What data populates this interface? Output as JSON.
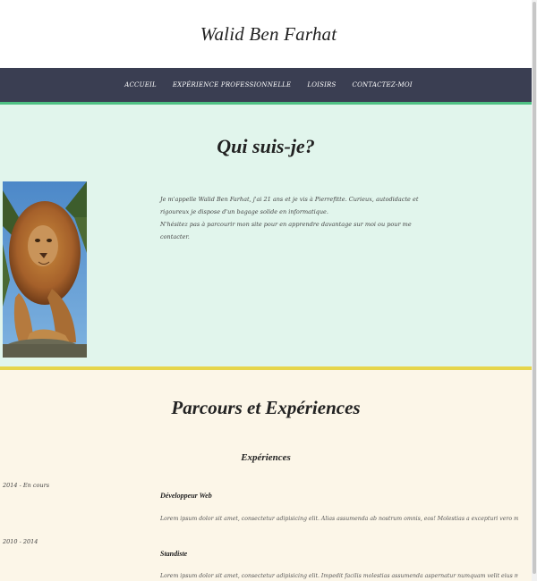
{
  "header": {
    "title": "Walid Ben Farhat"
  },
  "nav": {
    "items": [
      {
        "label": "Accueil"
      },
      {
        "label": "Expérience professionnelle"
      },
      {
        "label": "Loisirs"
      },
      {
        "label": "Contactez-moi"
      }
    ]
  },
  "about": {
    "title": "Qui suis-je?",
    "text_line1": "Je m'appelle Walid Ben Farhat, j'ai 21 ans et je vis à Pierrefitte. Curieux, autodidacte et rigoureux je dispose d'un bagage solide en informatique.",
    "text_line2": "N'hésitez pas à parcourir mon site pour en apprendre davantage sur moi ou pour me contacter."
  },
  "parcours": {
    "title": "Parcours et Expériences",
    "subheading": "Expériences",
    "entries": [
      {
        "date": "2014 - En cours",
        "job": "Développeur Web",
        "desc": "Lorem ipsum dolor sit amet, consectetur adipisicing elit. Alias assumenda ab nostrum omnis, eos! Molestias a excepturi vero maiores asperiores ipsam atque hic porro, ut ipsa quam! Quia cum, fugiat?"
      },
      {
        "date": "2010 - 2014",
        "job": "Standiste",
        "desc": "Lorem ipsum dolor sit amet, consectetur adipisicing elit. Impedit facilis molestias assumenda aspernatur numquam velit eius mollitia. Quod perferendis voluptatum, porro obcaecati minus consectetur fugit possimus, officiis"
      }
    ]
  },
  "colors": {
    "nav_bg": "#3a3e52",
    "nav_accent": "#4ec083",
    "about_bg": "#e1f5ec",
    "yellow_divider": "#e6d54a",
    "parcours_bg": "#fcf6e8"
  }
}
